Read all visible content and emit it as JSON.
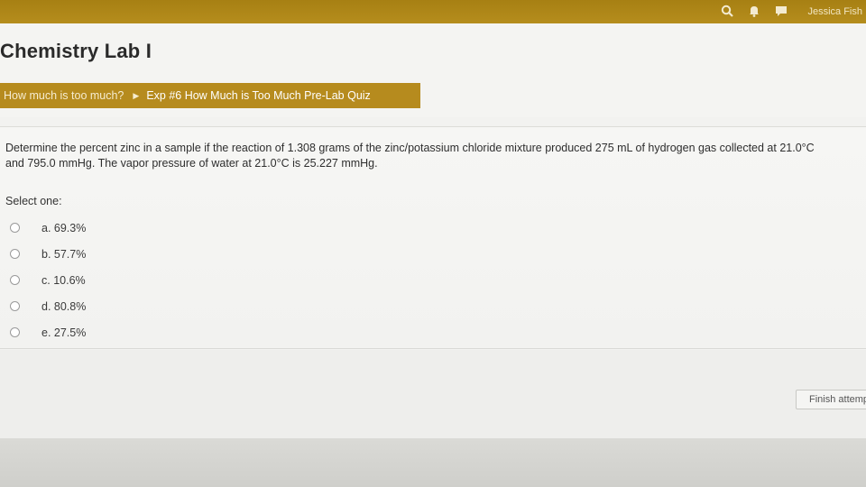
{
  "header": {
    "user_name": "Jessica Fish",
    "icons": [
      "search-icon",
      "notifications-icon",
      "messages-icon"
    ]
  },
  "course": {
    "title": "Chemistry Lab I"
  },
  "breadcrumb": {
    "parent": "How much is too much?",
    "current": "Exp #6 How Much is Too Much Pre-Lab Quiz"
  },
  "question": {
    "line1": "Determine the percent zinc in a sample if the reaction of 1.308 grams of the zinc/potassium chloride mixture produced 275 mL of hydrogen gas collected at 21.0°C",
    "line2": "and 795.0 mmHg.  The vapor pressure of water at 21.0°C is 25.227 mmHg.",
    "select_prompt": "Select one:",
    "options": [
      {
        "label": "a. 69.3%"
      },
      {
        "label": "b. 57.7%"
      },
      {
        "label": "c. 10.6%"
      },
      {
        "label": "d. 80.8%"
      },
      {
        "label": "e. 27.5%"
      }
    ]
  },
  "actions": {
    "finish_label": "Finish attempt"
  },
  "colors": {
    "brand_bar": "#b58d1d",
    "breadcrumb_bg": "#b68b1e"
  }
}
